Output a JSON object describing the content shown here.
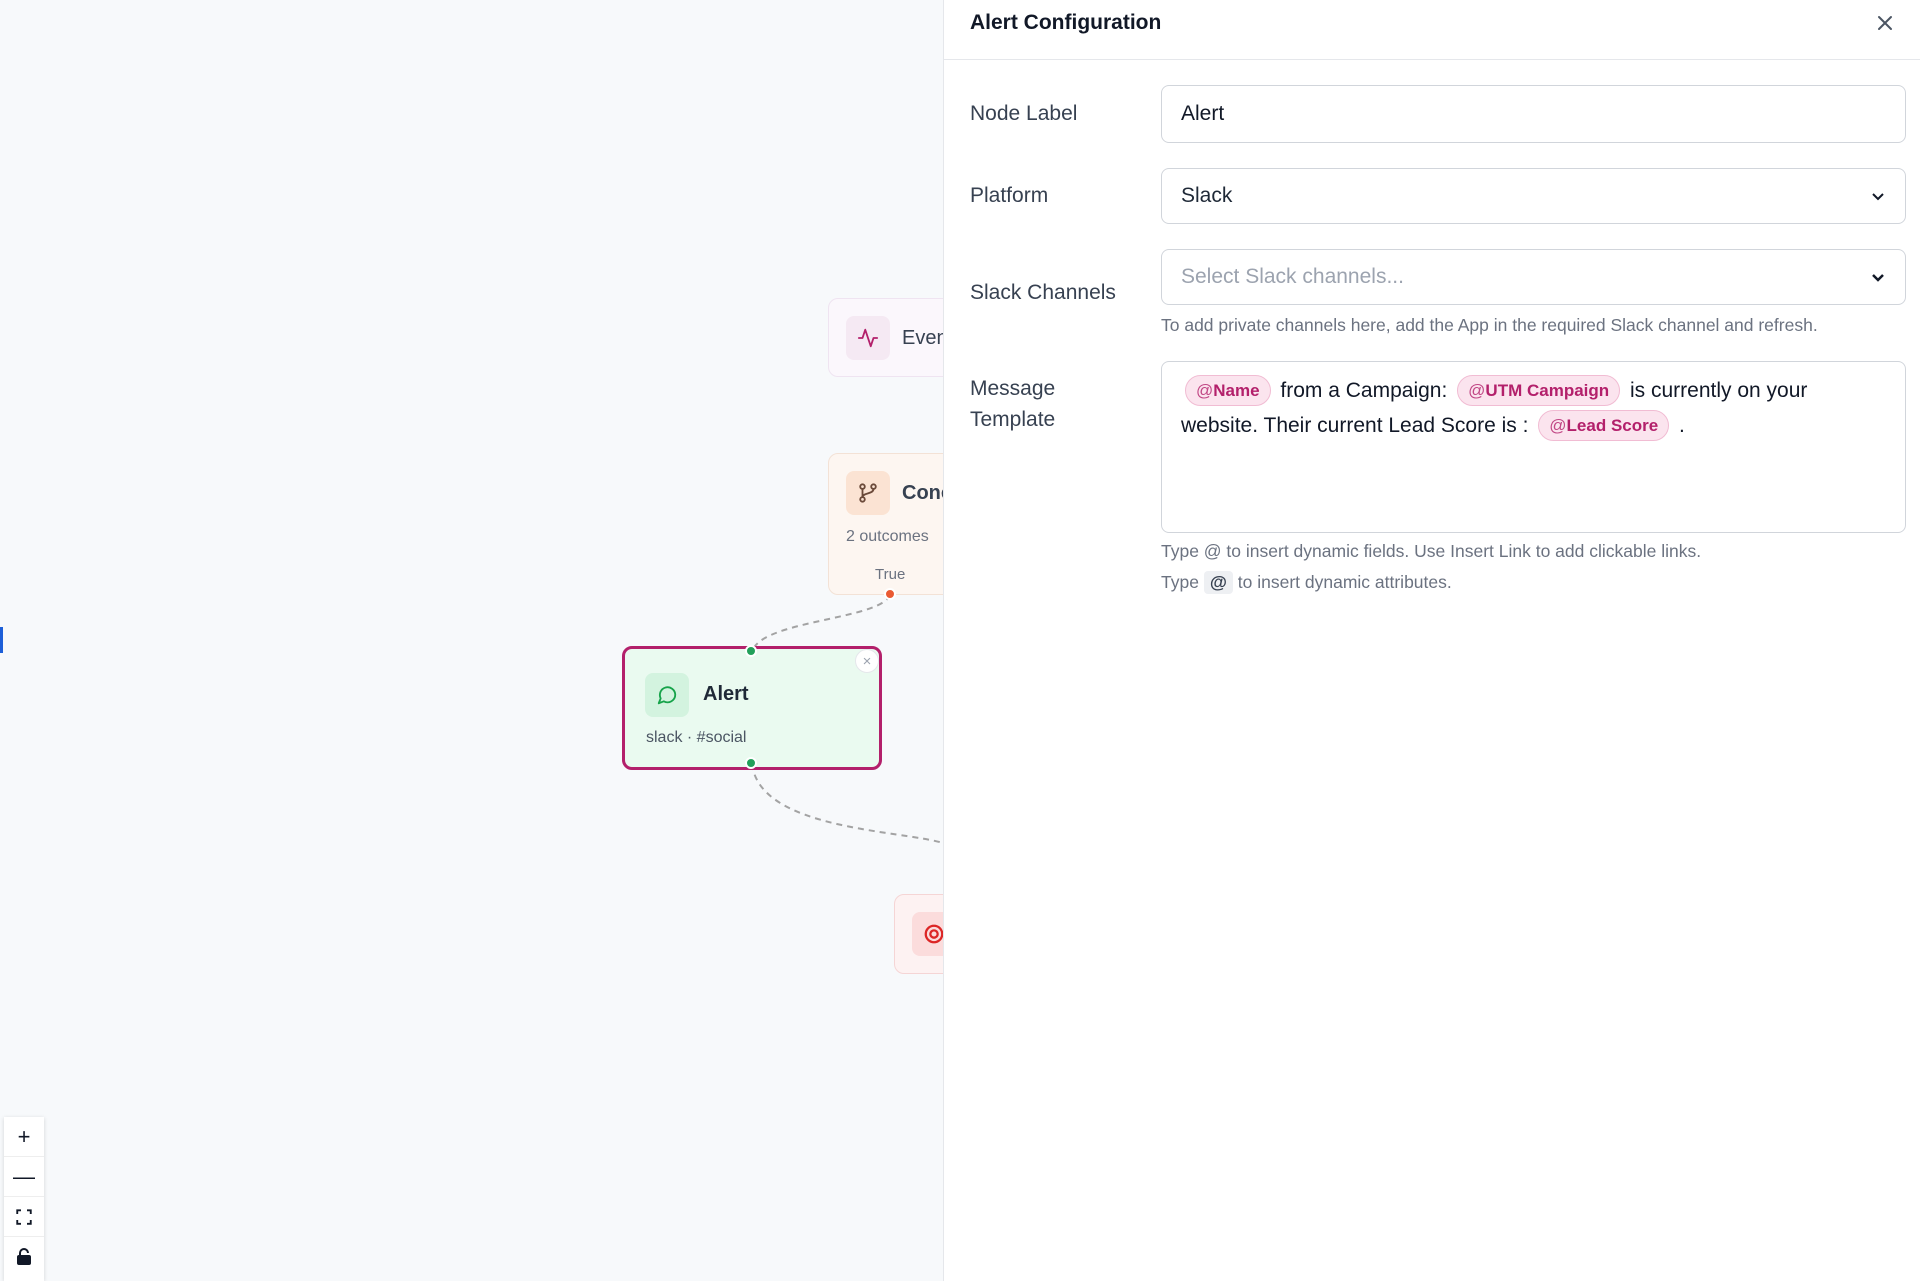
{
  "canvas": {
    "nodes": {
      "event": {
        "title": "Even"
      },
      "condition": {
        "title": "Conc",
        "outcomes": "2 outcomes",
        "branch_label": "True"
      },
      "alert": {
        "title": "Alert",
        "subtitle": "slack · #social",
        "close_glyph": "×"
      }
    },
    "controls": {
      "zoom_in": "+",
      "zoom_out": "—"
    }
  },
  "panel": {
    "title": "Alert Configuration",
    "node_label": {
      "label": "Node Label",
      "value": "Alert"
    },
    "platform": {
      "label": "Platform",
      "value": "Slack"
    },
    "slack_channels": {
      "label": "Slack Channels",
      "placeholder": "Select Slack channels...",
      "help": "To add private channels here, add the App in the required Slack channel and refresh."
    },
    "message_template": {
      "label_line1": "Message",
      "label_line2": "Template",
      "at": "@",
      "chip_name": "Name",
      "text_1": " from a Campaign: ",
      "chip_campaign": "UTM Campaign",
      "text_2": " is currently on your website. Their current Lead Score is : ",
      "chip_score": "Lead Score",
      "text_3": " .",
      "help_1": "Type @ to insert dynamic fields. Use Insert Link to add clickable links.",
      "help_2_prefix": "Type ",
      "help_2_badge": "@",
      "help_2_suffix": " to insert dynamic attributes."
    }
  },
  "colors": {
    "accent": "#b3206b",
    "alert_bg": "#eafaf0",
    "handle_green": "#22a05a",
    "handle_orange": "#ea5a32"
  }
}
